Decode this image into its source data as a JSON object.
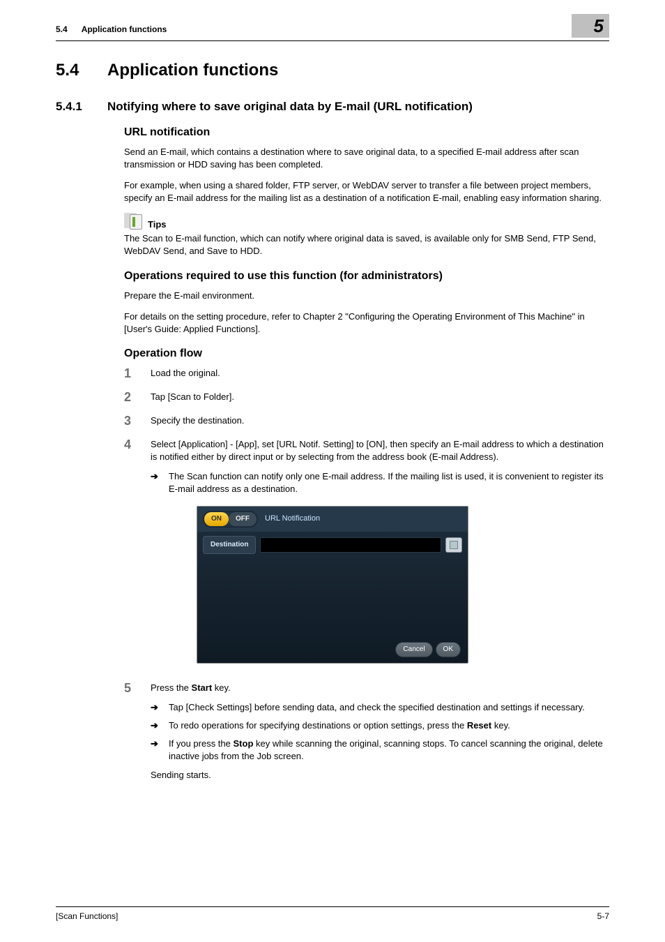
{
  "header": {
    "section_no": "5.4",
    "section_name": "Application functions",
    "chapter_badge": "5"
  },
  "title": {
    "num": "5.4",
    "text": "Application functions"
  },
  "subsection": {
    "num": "5.4.1",
    "text": "Notifying where to save original data by E-mail (URL notification)"
  },
  "url_notification": {
    "heading": "URL notification",
    "p1": "Send an E-mail, which contains a destination where to save original data, to a specified E-mail address after scan transmission or HDD saving has been completed.",
    "p2": "For example, when using a shared folder, FTP server, or WebDAV server to transfer a file between project members, specify an E-mail address for the mailing list as a destination of a notification E-mail, enabling easy information sharing."
  },
  "tips": {
    "label": "Tips",
    "text": "The Scan to E-mail function, which can notify where original data is saved, is available only for SMB Send, FTP Send, WebDAV Send, and Save to HDD."
  },
  "ops_required": {
    "heading": "Operations required to use this function (for administrators)",
    "p1": "Prepare the E-mail environment.",
    "p2": "For details on the setting procedure, refer to Chapter 2 \"Configuring the Operating Environment of This Machine\" in [User's Guide: Applied Functions]."
  },
  "operation_flow": {
    "heading": "Operation flow",
    "steps": [
      {
        "n": "1",
        "text": "Load the original."
      },
      {
        "n": "2",
        "text": "Tap [Scan to Folder]."
      },
      {
        "n": "3",
        "text": "Specify the destination."
      },
      {
        "n": "4",
        "text": "Select [Application] - [App], set [URL Notif. Setting] to [ON], then specify an E-mail address to which a destination is notified either by direct input or by selecting from the address book (E-mail Address).",
        "sub": [
          "The Scan function can notify only one E-mail address. If the mailing list is used, it is convenient to register its E-mail address as a destination."
        ]
      },
      {
        "n": "5",
        "text_prefix": "Press the ",
        "bold": "Start",
        "text_suffix": " key.",
        "sub": [
          "Tap [Check Settings] before sending data, and check the specified destination and settings if necessary.",
          "To redo operations for specifying destinations or option settings, press the Reset key.",
          "If you press the Stop key while scanning the original, scanning stops. To cancel scanning the original, delete inactive jobs from the Job screen."
        ],
        "after": "Sending starts."
      }
    ],
    "step5_sub_parts": {
      "s1": {
        "a": "To redo operations for specifying destinations or option settings, press the ",
        "b": "Reset",
        "c": " key."
      },
      "s2": {
        "a": "If you press the ",
        "b": "Stop",
        "c": " key while scanning the original, scanning stops. To cancel scanning the original, delete inactive jobs from the Job screen."
      }
    }
  },
  "screenshot": {
    "title": "URL Notification",
    "on": "ON",
    "off": "OFF",
    "destination": "Destination",
    "cancel": "Cancel",
    "ok": "OK"
  },
  "footer": {
    "left": "[Scan Functions]",
    "right": "5-7"
  }
}
